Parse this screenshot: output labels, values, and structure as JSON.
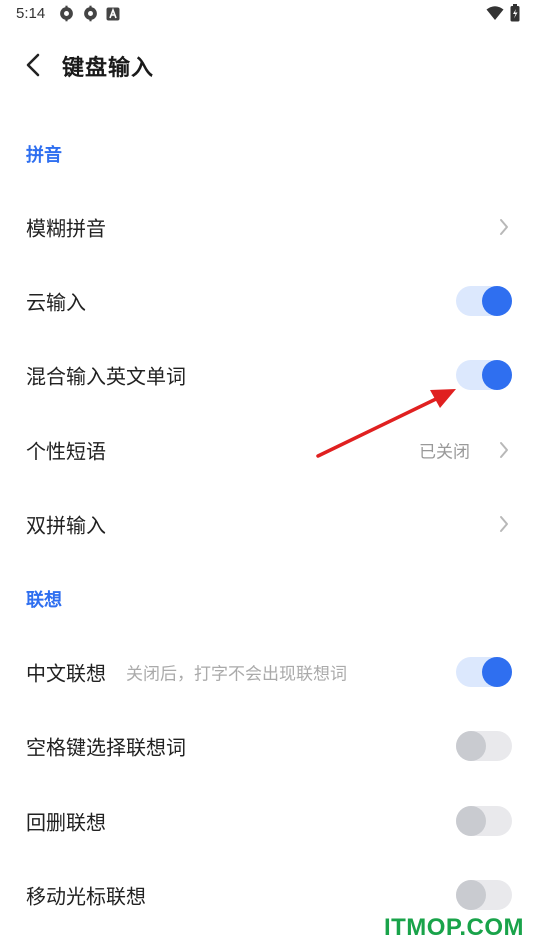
{
  "status_bar": {
    "time": "5:14",
    "icons_left": [
      "settings-icon",
      "settings-icon",
      "a-badge-icon"
    ],
    "icons_right": [
      "wifi-icon",
      "battery-icon"
    ]
  },
  "header": {
    "back_icon": "chevron-left-icon",
    "title": "键盘输入"
  },
  "sections": [
    {
      "title": "拼音",
      "rows": [
        {
          "label": "模糊拼音",
          "control": "chevron"
        },
        {
          "label": "云输入",
          "control": "toggle",
          "on": true
        },
        {
          "label": "混合输入英文单词",
          "control": "toggle",
          "on": true
        },
        {
          "label": "个性短语",
          "control": "chevron",
          "value": "已关闭"
        },
        {
          "label": "双拼输入",
          "control": "chevron"
        }
      ]
    },
    {
      "title": "联想",
      "rows": [
        {
          "label": "中文联想",
          "hint": "关闭后，打字不会出现联想词",
          "control": "toggle",
          "on": true
        },
        {
          "label": "空格键选择联想词",
          "control": "toggle",
          "on": false
        },
        {
          "label": "回删联想",
          "control": "toggle",
          "on": false
        },
        {
          "label": "移动光标联想",
          "control": "toggle",
          "on": false
        }
      ]
    }
  ],
  "colors": {
    "accent": "#2f6ff0",
    "toggle_on_track": "#dce8fd",
    "toggle_off_track": "#e9e9ec",
    "toggle_off_knob": "#c9cbd0",
    "annotation_arrow": "#e02020",
    "watermark": "#19a34a"
  },
  "watermark": "ITMOP.COM"
}
